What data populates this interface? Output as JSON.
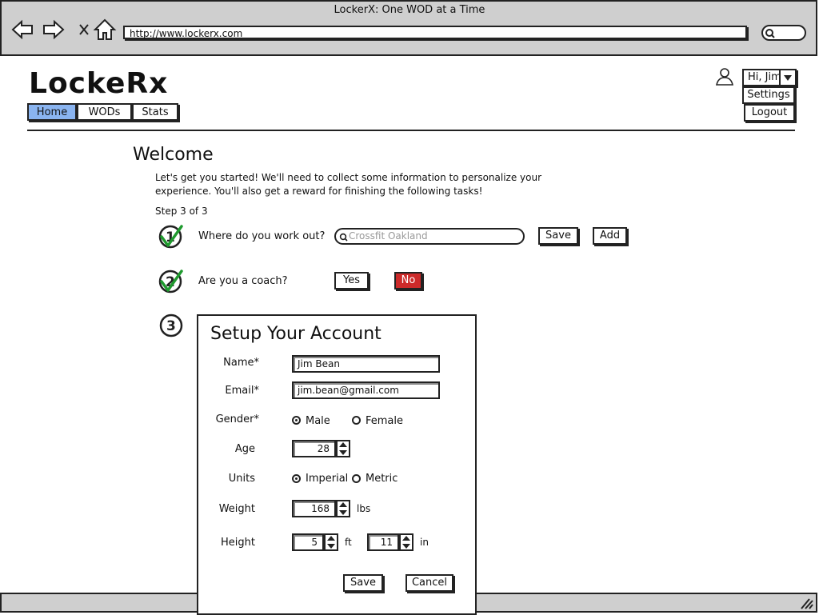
{
  "browser": {
    "window_title": "LockerX: One WOD at a Time",
    "url": "http://www.lockerx.com",
    "icons": [
      "back-arrow-icon",
      "forward-arrow-icon",
      "close-x-icon",
      "home-icon",
      "search-icon"
    ]
  },
  "app": {
    "logo": "LockeRx",
    "nav": {
      "home": "Home",
      "wods": "WODs",
      "stats": "Stats",
      "active": "Home"
    },
    "user_menu": {
      "greeting": "Hi, Jim",
      "settings": "Settings",
      "logout": "Logout"
    },
    "accent_color": "#8ab4f0"
  },
  "welcome": {
    "title": "Welcome",
    "intro_line1": "Let's get you started! We'll need to collect some information to personalize your",
    "intro_line2": "experience. You'll also get a reward for finishing the following tasks!",
    "step": "Step 3 of 3"
  },
  "steps": {
    "workout": {
      "number": "1",
      "question": "Where do you work out?",
      "search_placeholder": "Crossfit Oakland",
      "save": "Save",
      "add": "Add",
      "completed": true
    },
    "coach": {
      "number": "2",
      "question": "Are you a coach?",
      "yes": "Yes",
      "no": "No",
      "selected": "No",
      "selected_color": "#cc2a2a",
      "completed": true
    },
    "account": {
      "number": "3",
      "completed": false
    }
  },
  "account_form": {
    "title": "Setup Your Account",
    "name_label": "Name*",
    "name_value": "Jim Bean",
    "email_label": "Email*",
    "email_value": "jim.bean@gmail.com",
    "gender_label": "Gender*",
    "gender_male": "Male",
    "gender_female": "Female",
    "gender_selected": "Male",
    "age_label": "Age",
    "age_value": "28",
    "units_label": "Units",
    "units_imperial": "Imperial",
    "units_metric": "Metric",
    "units_selected": "Imperial",
    "weight_label": "Weight",
    "weight_value": "168",
    "weight_unit": "lbs",
    "height_label": "Height",
    "height_ft_value": "5",
    "height_ft_unit": "ft",
    "height_in_value": "11",
    "height_in_unit": "in",
    "save": "Save",
    "cancel": "Cancel"
  }
}
